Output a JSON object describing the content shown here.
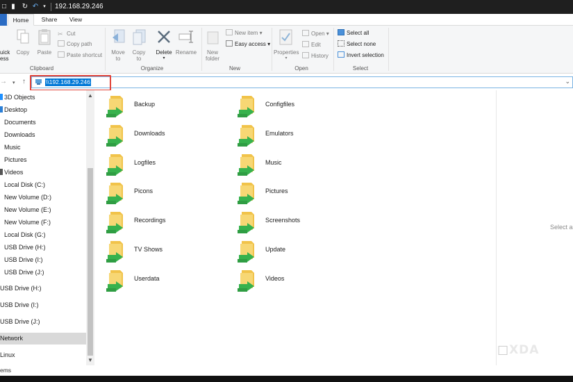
{
  "window": {
    "title": "192.168.29.246",
    "quick_access": [
      "properties-icon",
      "new-folder-icon",
      "redo-icon",
      "undo-icon",
      "dropdown-icon"
    ]
  },
  "ribbon_tabs": [
    {
      "label": "Home",
      "active": true
    },
    {
      "label": "Share",
      "active": false
    },
    {
      "label": "View",
      "active": false
    }
  ],
  "ribbon": {
    "clipboard": {
      "quick_access_line1": "uick",
      "quick_access_line2": "ess",
      "copy": "Copy",
      "paste": "Paste",
      "cut": "Cut",
      "copy_path": "Copy path",
      "paste_shortcut": "Paste shortcut",
      "label": "Clipboard"
    },
    "organize": {
      "move_to_line1": "Move",
      "move_to_line2": "to",
      "copy_to_line1": "Copy",
      "copy_to_line2": "to",
      "delete": "Delete",
      "rename": "Rename",
      "label": "Organize"
    },
    "new": {
      "new_folder_line1": "New",
      "new_folder_line2": "folder",
      "new_item": "New item",
      "easy_access": "Easy access",
      "label": "New"
    },
    "open": {
      "properties": "Properties",
      "open": "Open",
      "edit": "Edit",
      "history": "History",
      "label": "Open"
    },
    "select": {
      "select_all": "Select all",
      "select_none": "Select none",
      "invert_selection": "Invert selection",
      "label": "Select"
    }
  },
  "address_bar": {
    "path": "\\\\192.168.29.246",
    "back_icon": "back-arrow-icon",
    "forward_icon": "forward-arrow-icon",
    "recent_icon": "chevron-down-icon",
    "up_icon": "up-arrow-icon"
  },
  "nav_pane": {
    "items": [
      {
        "label": "3D Objects",
        "color": "#1e90ff"
      },
      {
        "label": "Desktop",
        "color": "#2b7fd6"
      },
      {
        "label": "Documents",
        "color": "#888888"
      },
      {
        "label": "Downloads",
        "color": "#2b7fd6"
      },
      {
        "label": "Music",
        "color": "#e87e2a"
      },
      {
        "label": "Pictures",
        "color": "#4aa3df"
      },
      {
        "label": "Videos",
        "color": "#7b4fc9"
      },
      {
        "label": "Local Disk (C:)",
        "color": "#888888"
      },
      {
        "label": "New Volume (D:)",
        "color": "#888888"
      },
      {
        "label": "New Volume (E:)",
        "color": "#888888"
      },
      {
        "label": "New Volume (F:)",
        "color": "#888888"
      },
      {
        "label": "Local Disk (G:)",
        "color": "#888888"
      },
      {
        "label": "USB Drive (H:)",
        "color": "#888888"
      },
      {
        "label": "USB Drive (I:)",
        "color": "#888888"
      },
      {
        "label": "USB Drive (J:)",
        "color": "#888888"
      }
    ],
    "group_items": [
      {
        "label": "USB Drive (H:)"
      },
      {
        "label": "USB Drive (I:)"
      },
      {
        "label": "USB Drive (J:)"
      },
      {
        "label": "Network",
        "selected": true
      },
      {
        "label": "Linux"
      }
    ]
  },
  "folders": [
    {
      "name": "Backup"
    },
    {
      "name": "Configfiles"
    },
    {
      "name": "Downloads"
    },
    {
      "name": "Emulators"
    },
    {
      "name": "Logfiles"
    },
    {
      "name": "Music"
    },
    {
      "name": "Picons"
    },
    {
      "name": "Pictures"
    },
    {
      "name": "Recordings"
    },
    {
      "name": "Screenshots"
    },
    {
      "name": "TV Shows"
    },
    {
      "name": "Update"
    },
    {
      "name": "Userdata"
    },
    {
      "name": "Videos"
    }
  ],
  "preview_pane": {
    "text": "Select a"
  },
  "status_bar": {
    "text": "ems"
  },
  "watermark": "XDA",
  "colors": {
    "accent": "#0078d7",
    "highlight_box": "#e0443a",
    "folder_yellow": "#f6cf5a",
    "share_green": "#37b24d"
  }
}
